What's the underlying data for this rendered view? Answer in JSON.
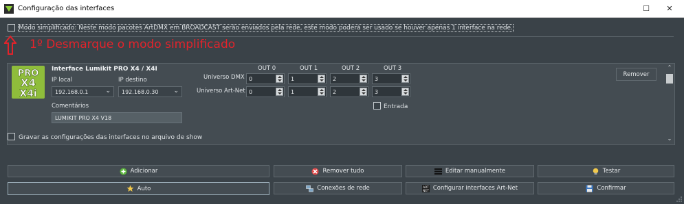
{
  "window": {
    "title": "Configuração das interfaces",
    "minimize_glyph": "☐",
    "close_glyph": "✕"
  },
  "simple_mode": {
    "label": "Modo simplificado: Neste modo pacotes ArtDMX em BROADCAST serão enviados pela rede, este modo poderá ser usado se houver apenas 1 interface na rede.",
    "checked": false
  },
  "annotation": {
    "text": "1º Desmarque o modo simplificado",
    "color": "#e4232b"
  },
  "interface": {
    "title": "Interface Lumikit PRO X4 / X4I",
    "logo_text": [
      "PRO",
      "X4",
      "X4i"
    ],
    "ip_local_label": "IP local",
    "ip_local_value": "192.168.0.1",
    "ip_dest_label": "IP destino",
    "ip_dest_value": "192.168.0.30",
    "comments_label": "Comentários",
    "comments_value": "LUMIKIT PRO X4 V18",
    "outputs": [
      "OUT 0",
      "OUT 1",
      "OUT 2",
      "OUT 3"
    ],
    "universe_dmx_label": "Universo DMX",
    "universe_dmx_values": [
      "0",
      "1",
      "2",
      "3"
    ],
    "universe_artnet_label": "Universo Art-Net",
    "universe_artnet_values": [
      "0",
      "1",
      "2",
      "3"
    ],
    "input_label": "Entrada",
    "remove_label": "Remover"
  },
  "save_config": {
    "label": "Gravar as configurações das interfaces no arquivo de show",
    "checked": false
  },
  "buttons": {
    "add": "Adicionar",
    "remove_all": "Remover tudo",
    "edit_manual": "Editar manualmente",
    "test": "Testar",
    "auto": "Auto",
    "net_connections": "Conexões de rede",
    "configure_artnet": "Configurar interfaces Art-Net",
    "confirm": "Confirmar"
  },
  "colors": {
    "background": "#3a4248",
    "panel": "#444c52",
    "logo_green": "#8fbd3b",
    "annotation_red": "#e4232b"
  }
}
